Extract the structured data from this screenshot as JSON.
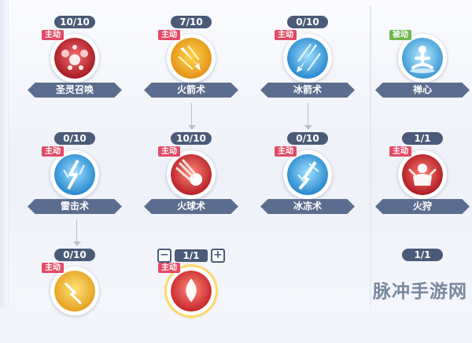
{
  "colors": {
    "badge_bg": "#4a5a78",
    "name_banner": "#5b6d8e",
    "active_tag": "#e24a66",
    "passive_tag": "#6fb84e",
    "arrow": "#b9c0cf"
  },
  "skills": [
    {
      "level": "10/10",
      "tag": "主动",
      "name": "圣灵召唤",
      "icon": "red-orbs-icon"
    },
    {
      "level": "7/10",
      "tag": "主动",
      "name": "火箭术",
      "icon": "flame-arrow-icon"
    },
    {
      "level": "0/10",
      "tag": "主动",
      "name": "冰箭术",
      "icon": "ice-arrow-icon"
    },
    {
      "level": "",
      "tag": "被动",
      "name": "禅心",
      "icon": "meditation-icon"
    },
    {
      "level": "0/10",
      "tag": "主动",
      "name": "雷击术",
      "icon": "lightning-icon"
    },
    {
      "level": "10/10",
      "tag": "主动",
      "name": "火球术",
      "icon": "fireball-icon"
    },
    {
      "level": "0/10",
      "tag": "主动",
      "name": "冰冻术",
      "icon": "ice-shard-icon"
    },
    {
      "level": "1/1",
      "tag": "主动",
      "name": "火狩",
      "icon": "fire-beast-icon"
    },
    {
      "level": "0/10",
      "tag": "主动",
      "name": "",
      "icon": "yellow-spark-icon"
    },
    {
      "level": "1/1",
      "tag": "主动",
      "name": "",
      "icon": "flame-icon"
    },
    {
      "level": "1/1",
      "tag": "",
      "name": "",
      "icon": "partial-icon"
    }
  ],
  "stepper": {
    "minus": "−",
    "plus": "+"
  },
  "watermark": "脉冲手游网"
}
